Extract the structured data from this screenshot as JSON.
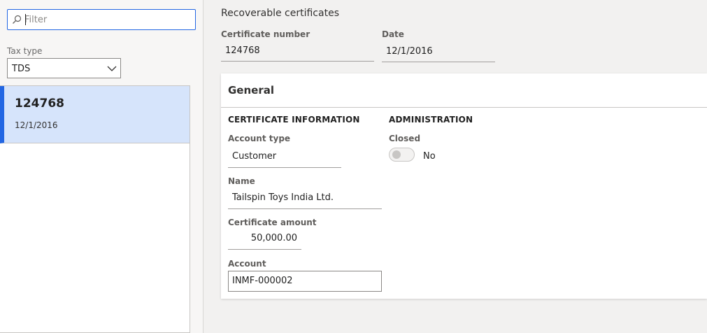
{
  "filter": {
    "placeholder": "Filter",
    "icon": "search-icon"
  },
  "tax_type": {
    "label": "Tax type",
    "value": "TDS"
  },
  "list": {
    "items": [
      {
        "number": "124768",
        "date": "12/1/2016",
        "selected": true
      }
    ]
  },
  "header": {
    "title": "Recoverable certificates",
    "certificate_number_label": "Certificate number",
    "certificate_number": "124768",
    "date_label": "Date",
    "date": "12/1/2016"
  },
  "general": {
    "title": "General",
    "certificate_information": {
      "heading": "CERTIFICATE INFORMATION",
      "account_type_label": "Account type",
      "account_type": "Customer",
      "name_label": "Name",
      "name": "Tailspin Toys India Ltd.",
      "amount_label": "Certificate amount",
      "amount": "50,000.00",
      "account_label": "Account",
      "account": "INMF-000002"
    },
    "administration": {
      "heading": "ADMINISTRATION",
      "closed_label": "Closed",
      "closed_value": "No"
    }
  },
  "colors": {
    "accent": "#2266e3",
    "selection": "#d6e4fb"
  }
}
